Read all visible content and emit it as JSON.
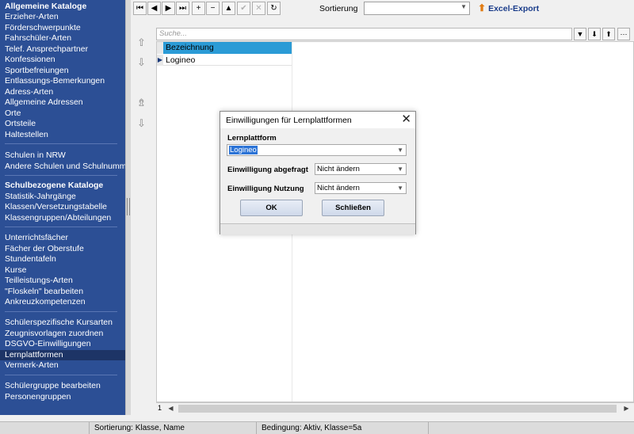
{
  "sidebar": {
    "items": [
      {
        "label": "Allgemeine Kataloge",
        "head": true
      },
      {
        "label": "Erzieher-Arten"
      },
      {
        "label": "Förderschwerpunkte"
      },
      {
        "label": "Fahrschüler-Arten"
      },
      {
        "label": "Telef. Ansprechpartner"
      },
      {
        "label": "Konfessionen"
      },
      {
        "label": "Sportbefreiungen"
      },
      {
        "label": "Entlassungs-Bemerkungen"
      },
      {
        "label": "Adress-Arten"
      },
      {
        "label": "Allgemeine Adressen"
      },
      {
        "label": "Orte"
      },
      {
        "label": "Ortsteile"
      },
      {
        "label": "Haltestellen"
      },
      {
        "label": "Schulen in NRW"
      },
      {
        "label": "Andere Schulen und Schulnummern"
      },
      {
        "label": "Schulbezogene Kataloge",
        "head": true
      },
      {
        "label": "Statistik-Jahrgänge"
      },
      {
        "label": "Klassen/Versetzungstabelle"
      },
      {
        "label": "Klassengruppen/Abteilungen"
      },
      {
        "label": "Unterrichtsfächer"
      },
      {
        "label": "Fächer der Oberstufe"
      },
      {
        "label": "Stundentafeln"
      },
      {
        "label": "Kurse"
      },
      {
        "label": "Teilleistungs-Arten"
      },
      {
        "label": "\"Floskeln\" bearbeiten"
      },
      {
        "label": "Ankreuzkompetenzen"
      },
      {
        "label": "Schülerspezifische Kursarten"
      },
      {
        "label": "Zeugnisvorlagen zuordnen"
      },
      {
        "label": "DSGVO-Einwilligungen"
      },
      {
        "label": "Lernplattformen",
        "selected": true
      },
      {
        "label": "Vermerk-Arten"
      },
      {
        "label": "Schülergruppe bearbeiten"
      },
      {
        "label": "Personengruppen"
      }
    ]
  },
  "toolbar": {
    "buttons": [
      {
        "name": "first-record",
        "glyph": "⏮"
      },
      {
        "name": "prev-record",
        "glyph": "◀"
      },
      {
        "name": "next-record",
        "glyph": "▶"
      },
      {
        "name": "last-record",
        "glyph": "⏭"
      },
      {
        "name": "add-record",
        "glyph": "+"
      },
      {
        "name": "delete-record",
        "glyph": "−"
      },
      {
        "name": "edit-record",
        "glyph": "▲"
      },
      {
        "name": "confirm-record",
        "glyph": "✔",
        "disabled": true
      },
      {
        "name": "cancel-record",
        "glyph": "✕",
        "disabled": true
      },
      {
        "name": "refresh",
        "glyph": "↻"
      }
    ],
    "sort_label": "Sortierung",
    "sort_value": "",
    "excel_label": "Excel-Export"
  },
  "search": {
    "placeholder": "Suche..."
  },
  "grid": {
    "column": "Bezeichnung",
    "rows": [
      "Logineo"
    ],
    "row_count": "1"
  },
  "dialog": {
    "title": "Einwilligungen für Lernplattformen",
    "lernplattform_label": "Lernplattform",
    "lernplattform_value": "Logineo",
    "abgefragt_label": "Einwilligung abgefragt",
    "abgefragt_value": "Nicht ändern",
    "nutzung_label": "Einwilligung Nutzung",
    "nutzung_value": "Nicht ändern",
    "ok_label": "OK",
    "close_label": "Schließen"
  },
  "statusbar": {
    "sortierung": "Sortierung: Klasse, Name",
    "bedingung": "Bedingung: Aktiv, Klasse=5a"
  }
}
